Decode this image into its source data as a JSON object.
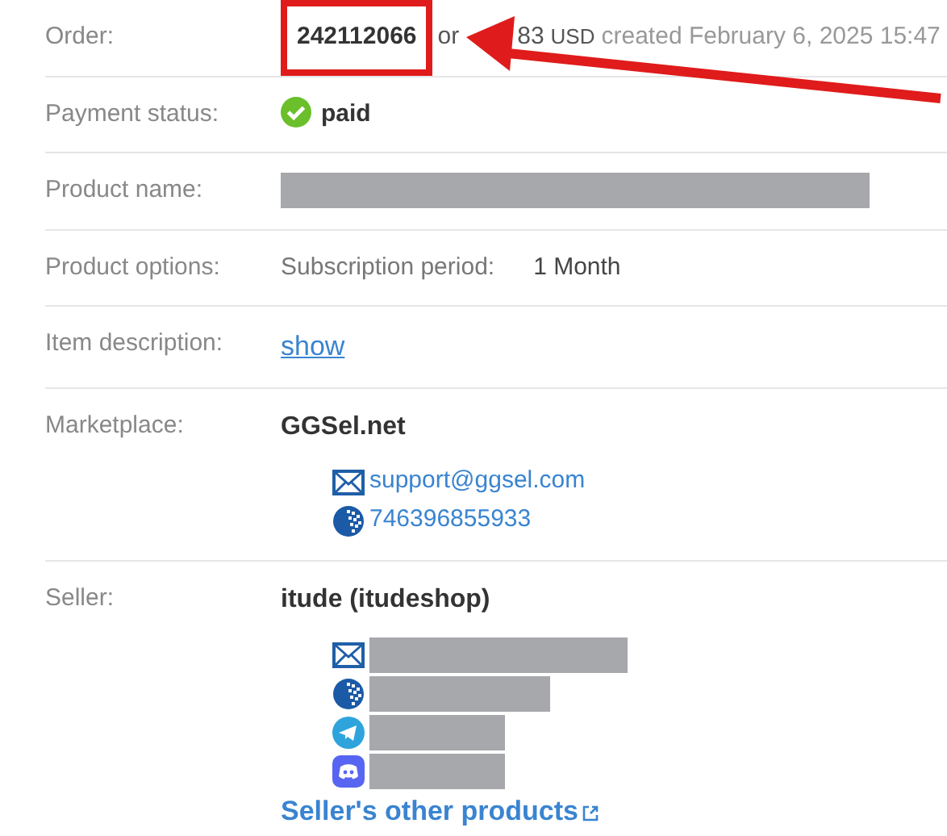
{
  "rows": [
    {
      "kind": "order",
      "label": "Order:",
      "number": "242112066",
      "highlighted": true,
      "amount_parts": [
        "or",
        "83"
      ],
      "currency": "USD",
      "created": "created February 6, 2025 15:47"
    },
    {
      "kind": "status",
      "label": "Payment status:",
      "status": "paid"
    },
    {
      "kind": "redacted",
      "label": "Product name:"
    },
    {
      "kind": "option",
      "label": "Product options:",
      "option_name": "Subscription period:",
      "option_value": "1 Month"
    },
    {
      "kind": "link",
      "label": "Item description:",
      "link": "show"
    },
    {
      "kind": "contact",
      "label": "Marketplace:",
      "name": "GGSel.net",
      "contacts": [
        {
          "kind": "email",
          "text": "support@ggsel.com"
        },
        {
          "kind": "webmoney",
          "text": "746396855933"
        }
      ]
    },
    {
      "kind": "contact",
      "label": "Seller:",
      "name": "itude (itudeshop)",
      "contacts": [
        {
          "kind": "email",
          "redacted": true
        },
        {
          "kind": "webmoney",
          "redacted": true
        },
        {
          "kind": "telegram",
          "redacted": true
        },
        {
          "kind": "discord",
          "redacted": true
        }
      ],
      "link": "Seller's other products"
    }
  ]
}
